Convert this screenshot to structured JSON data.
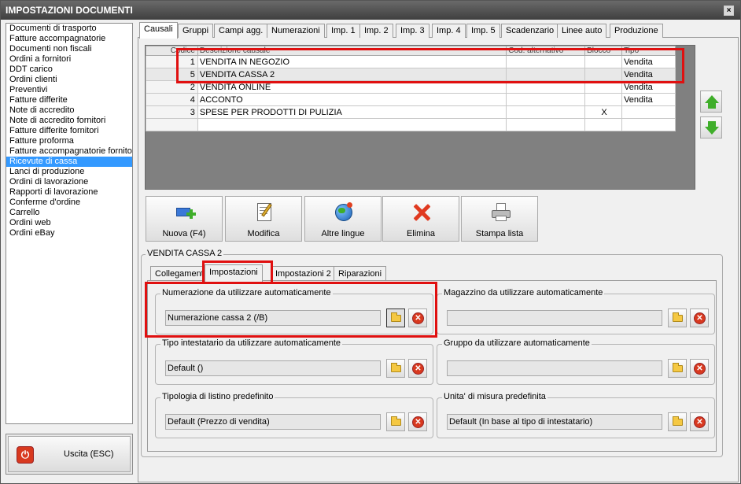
{
  "window": {
    "title": "IMPOSTAZIONI DOCUMENTI",
    "close_glyph": "×"
  },
  "doc_types": [
    "Documenti di trasporto",
    "Fatture accompagnatorie",
    "Documenti non fiscali",
    "Ordini a fornitori",
    "DDT carico",
    "Ordini clienti",
    "Preventivi",
    "Fatture differite",
    "Note di accredito",
    "Note di accredito fornitori",
    "Fatture differite fornitori",
    "Fatture proforma",
    "Fatture accompagnatorie fornito",
    "Ricevute di cassa",
    "Lanci di produzione",
    "Ordini di lavorazione",
    "Rapporti di lavorazione",
    "Conferme d'ordine",
    "Carrello",
    "Ordini web",
    "Ordini eBay"
  ],
  "selected_doc_type_index": 13,
  "exit_button": {
    "label": "Uscita (ESC)",
    "icon": "power-icon",
    "glyph": "⏻"
  },
  "tabs": [
    "Causali",
    "Gruppi",
    "Campi agg.",
    "Numerazioni",
    "Imp. 1",
    "Imp. 2",
    "Imp. 3",
    "Imp. 4",
    "Imp. 5",
    "Scadenzario",
    "Linee auto",
    "Produzione"
  ],
  "active_tab_index": 0,
  "grid": {
    "headers": [
      "Codice",
      "Descrizione causale",
      "Cod. alternativo",
      "Blocco",
      "Tipo"
    ],
    "rows": [
      {
        "code": "1",
        "desc": "VENDITA IN NEGOZIO",
        "alt": "",
        "block": "",
        "type": "Vendita"
      },
      {
        "code": "5",
        "desc": "VENDITA CASSA 2",
        "alt": "",
        "block": "",
        "type": "Vendita"
      },
      {
        "code": "2",
        "desc": "VENDITA ONLINE",
        "alt": "",
        "block": "",
        "type": "Vendita"
      },
      {
        "code": "4",
        "desc": "ACCONTO",
        "alt": "",
        "block": "",
        "type": "Vendita"
      },
      {
        "code": "3",
        "desc": "SPESE PER PRODOTTI DI PULIZIA",
        "alt": "",
        "block": "X",
        "type": ""
      },
      {
        "code": "",
        "desc": "",
        "alt": "",
        "block": "",
        "type": ""
      }
    ]
  },
  "toolbar": {
    "new": "Nuova (F4)",
    "edit": "Modifica",
    "languages": "Altre lingue",
    "delete": "Elimina",
    "print": "Stampa lista"
  },
  "detail": {
    "title": "VENDITA CASSA 2",
    "subtabs": [
      "Collegamenti",
      "Impostazioni",
      "Impostazioni 2",
      "Riparazioni"
    ],
    "active_subtab_index": 1,
    "groups": [
      {
        "label": "Numerazione da utilizzare automaticamente",
        "value": "Numerazione cassa 2 (/B)"
      },
      {
        "label": "Magazzino da utilizzare automaticamente",
        "value": ""
      },
      {
        "label": "Tipo intestatario da utilizzare automaticamente",
        "value": "Default ()"
      },
      {
        "label": "Gruppo da utilizzare automaticamente",
        "value": ""
      },
      {
        "label": "Tipologia di listino predefinito",
        "value": "Default (Prezzo di vendita)"
      },
      {
        "label": "Unita' di misura predefinita",
        "value": "Default (In base al tipo di intestatario)"
      }
    ],
    "clear_glyph": "✕"
  },
  "colors": {
    "highlight": "#e01010",
    "selection": "#3399ff",
    "arrow_green": "#3fae2a"
  }
}
